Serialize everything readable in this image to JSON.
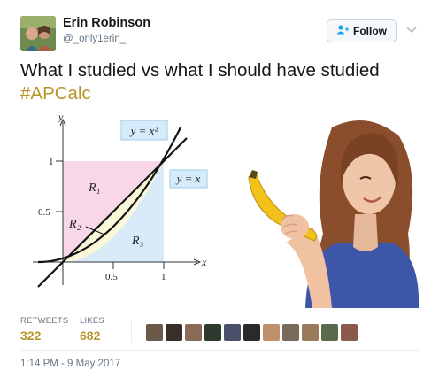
{
  "user": {
    "name": "Erin Robinson",
    "handle": "@_only1erin_"
  },
  "follow_label": "Follow",
  "tweet": {
    "text": "What I studied vs what I should have studied",
    "hashtag": "#APCalc"
  },
  "graph": {
    "y_axis": "y",
    "x_axis": "x",
    "eq_square": "y = x²",
    "eq_linear": "y = x",
    "r1": "R₁",
    "r2": "R₂",
    "r3": "R₃",
    "tick_y1": "1",
    "tick_y05": "0.5",
    "tick_x05": "0.5",
    "tick_x1": "1"
  },
  "stats": {
    "retweets_label": "RETWEETS",
    "retweets": "322",
    "likes_label": "LIKES",
    "likes": "682"
  },
  "timestamp": "1:14 PM - 9 May 2017",
  "colors": {
    "accent": "#b8952a",
    "follow_icon": "#1da1f2"
  },
  "likers": [
    "#6b5a4a",
    "#3a2e2a",
    "#8a6b55",
    "#2e3a2e",
    "#4a4f6a",
    "#2a2a2a",
    "#c0906a",
    "#7a6a5a",
    "#9a7a5a",
    "#5a6a4a",
    "#8a5a4a"
  ]
}
